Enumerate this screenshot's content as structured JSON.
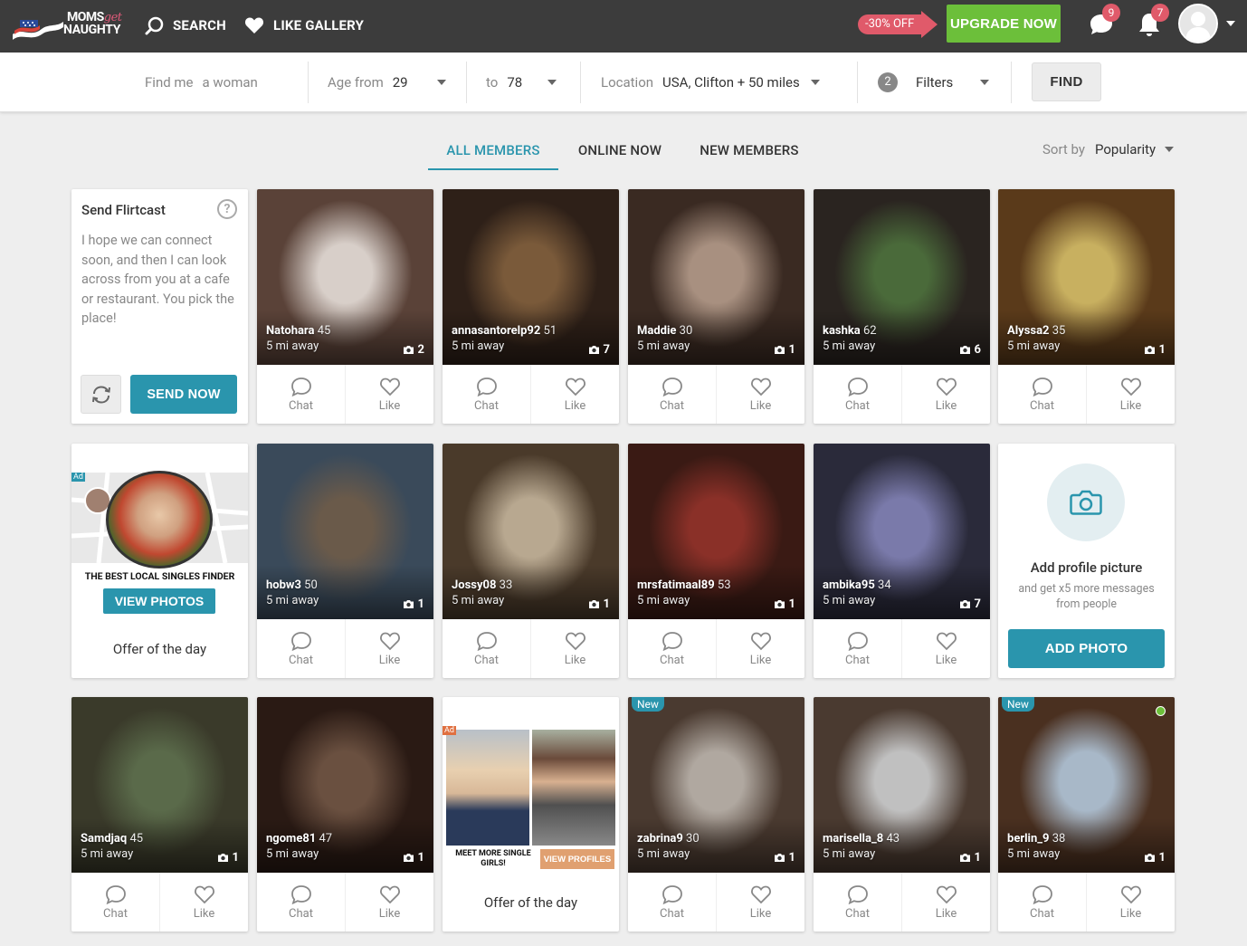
{
  "topbar": {
    "logo_line1": "MOMS",
    "logo_line1_script": "get",
    "logo_line2": "NAUGHTY",
    "search_label": "SEARCH",
    "like_gallery_label": "LIKE GALLERY",
    "discount_label": "-30% OFF",
    "upgrade_label": "UPGRADE NOW",
    "messages_badge": "9",
    "notifications_badge": "7",
    "colors": {
      "bg": "#3c3c3c",
      "upgrade": "#6cbf3a",
      "badge": "#e05a6a"
    }
  },
  "search": {
    "find_me_label": "Find me",
    "find_me_value": "a woman",
    "age_from_label": "Age from",
    "age_from_value": "29",
    "age_to_label": "to",
    "age_to_value": "78",
    "location_label": "Location",
    "location_value": "USA, Clifton + 50 miles",
    "filters_count": "2",
    "filters_label": "Filters",
    "find_button": "FIND"
  },
  "tabs": [
    {
      "label": "ALL MEMBERS",
      "active": true
    },
    {
      "label": "ONLINE NOW",
      "active": false
    },
    {
      "label": "NEW MEMBERS",
      "active": false
    }
  ],
  "sort": {
    "label": "Sort by",
    "value": "Popularity"
  },
  "flirtcast": {
    "title": "Send Flirtcast",
    "help": "?",
    "message": "I hope we can connect soon, and then I can look across from you at a cafe or restaurant. You pick the place!",
    "send_button": "SEND NOW"
  },
  "ad1": {
    "ad_tag": "Ad",
    "headline": "THE BEST LOCAL SINGLES FINDER",
    "button": "VIEW PHOTOS",
    "offer": "Offer of the day"
  },
  "ad2": {
    "ad_tag": "Ad",
    "headline": "MEET MORE SINGLE GIRLS!",
    "button": "VIEW PROFILES",
    "offer": "Offer of the day"
  },
  "add_photo": {
    "title": "Add profile picture",
    "subtitle": "and get x5 more messages from people",
    "button": "ADD PHOTO"
  },
  "actions": {
    "chat": "Chat",
    "like": "Like"
  },
  "badges": {
    "new": "New"
  },
  "members": [
    {
      "name": "Natohara",
      "age": "45",
      "distance": "5 mi away",
      "photos": "2",
      "bg": [
        "#d8cfc9",
        "#5a4238"
      ]
    },
    {
      "name": "annasantorelp92",
      "age": "51",
      "distance": "5 mi away",
      "photos": "7",
      "bg": [
        "#7a5a3a",
        "#2e2018"
      ]
    },
    {
      "name": "Maddie",
      "age": "30",
      "distance": "5 mi away",
      "photos": "1",
      "bg": [
        "#a89080",
        "#3a2a22"
      ]
    },
    {
      "name": "kashka",
      "age": "62",
      "distance": "5 mi away",
      "photos": "6",
      "bg": [
        "#4a6a3a",
        "#2a2420"
      ]
    },
    {
      "name": "Alyssa2",
      "age": "35",
      "distance": "5 mi away",
      "photos": "1",
      "bg": [
        "#c8b060",
        "#5a3a1a"
      ]
    },
    {
      "name": "hobw3",
      "age": "50",
      "distance": "5 mi away",
      "photos": "1",
      "bg": [
        "#6a5a4a",
        "#3a4a5a"
      ]
    },
    {
      "name": "Jossy08",
      "age": "33",
      "distance": "5 mi away",
      "photos": "1",
      "bg": [
        "#b8a890",
        "#4a3a2a"
      ]
    },
    {
      "name": "mrsfatimaal89",
      "age": "53",
      "distance": "5 mi away",
      "photos": "1",
      "bg": [
        "#8a3028",
        "#3a1a14"
      ]
    },
    {
      "name": "ambika95",
      "age": "34",
      "distance": "5 mi away",
      "photos": "7",
      "bg": [
        "#7a7aaa",
        "#2a2a3a"
      ]
    },
    {
      "name": "Samdjaq",
      "age": "45",
      "distance": "5 mi away",
      "photos": "1",
      "bg": [
        "#5a6a4a",
        "#3a3a2a"
      ]
    },
    {
      "name": "ngome81",
      "age": "47",
      "distance": "5 mi away",
      "photos": "1",
      "bg": [
        "#6a5040",
        "#2a1a14"
      ]
    },
    {
      "name": "zabrina9",
      "age": "30",
      "distance": "5 mi away",
      "photos": "1",
      "isNew": true,
      "bg": [
        "#b0a8a0",
        "#4a3a30"
      ]
    },
    {
      "name": "marisella_8",
      "age": "43",
      "distance": "5 mi away",
      "photos": "1",
      "bg": [
        "#c0c0c0",
        "#4a3a30"
      ]
    },
    {
      "name": "berlin_9",
      "age": "38",
      "distance": "5 mi away",
      "photos": "1",
      "isNew": true,
      "online": true,
      "bg": [
        "#a8b8c8",
        "#4a3020"
      ]
    }
  ]
}
